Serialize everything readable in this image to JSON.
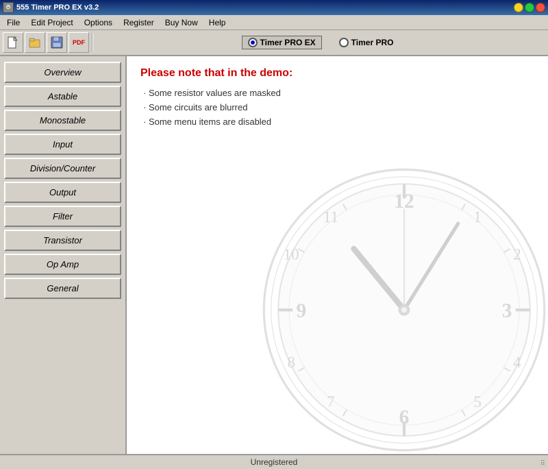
{
  "titleBar": {
    "title": "555 Timer PRO EX v3.2",
    "controls": {
      "minimize": "minimize",
      "maximize": "maximize",
      "close": "close"
    }
  },
  "menuBar": {
    "items": [
      {
        "label": "File",
        "id": "file"
      },
      {
        "label": "Edit Project",
        "id": "edit-project"
      },
      {
        "label": "Options",
        "id": "options"
      },
      {
        "label": "Register",
        "id": "register"
      },
      {
        "label": "Buy Now",
        "id": "buy-now"
      },
      {
        "label": "Help",
        "id": "help"
      }
    ]
  },
  "toolbar": {
    "buttons": [
      {
        "id": "new",
        "icon": "📄",
        "tooltip": "New"
      },
      {
        "id": "open",
        "icon": "📂",
        "tooltip": "Open"
      },
      {
        "id": "save",
        "icon": "💾",
        "tooltip": "Save"
      },
      {
        "id": "pdf",
        "icon": "📋",
        "tooltip": "Export PDF"
      }
    ],
    "radioGroup": {
      "options": [
        {
          "id": "timer-pro-ex",
          "label": "Timer PRO EX",
          "selected": true
        },
        {
          "id": "timer-pro",
          "label": "Timer PRO",
          "selected": false
        }
      ]
    }
  },
  "sidebar": {
    "buttons": [
      {
        "id": "overview",
        "label": "Overview"
      },
      {
        "id": "astable",
        "label": "Astable"
      },
      {
        "id": "monostable",
        "label": "Monostable"
      },
      {
        "id": "input",
        "label": "Input"
      },
      {
        "id": "division-counter",
        "label": "Division/Counter"
      },
      {
        "id": "output",
        "label": "Output"
      },
      {
        "id": "filter",
        "label": "Filter"
      },
      {
        "id": "transistor",
        "label": "Transistor"
      },
      {
        "id": "op-amp",
        "label": "Op Amp"
      },
      {
        "id": "general",
        "label": "General"
      }
    ]
  },
  "content": {
    "demoNotice": {
      "title": "Please note that in the demo:",
      "items": [
        "· Some resistor values are masked",
        "· Some circuits are blurred",
        "· Some menu items are disabled"
      ]
    }
  },
  "statusBar": {
    "text": "Unregistered"
  }
}
